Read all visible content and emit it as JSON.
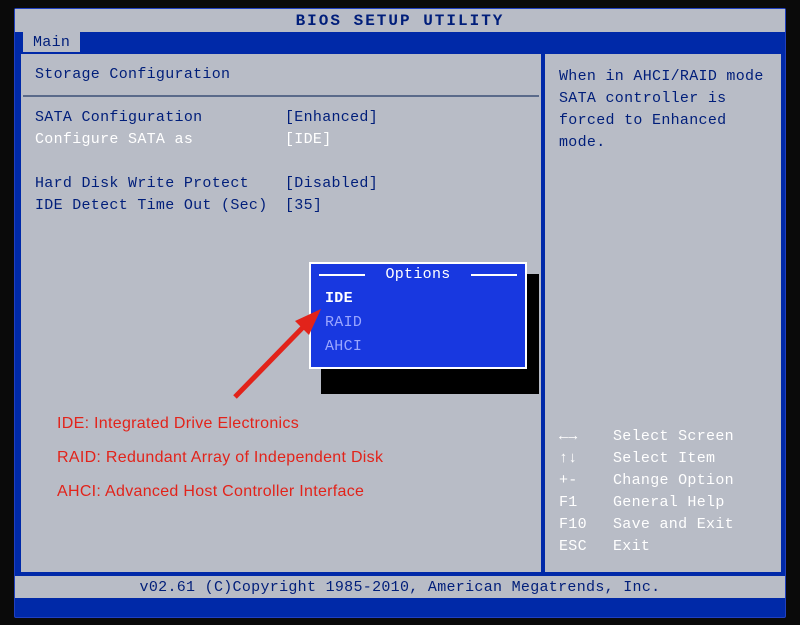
{
  "title": "BIOS SETUP UTILITY",
  "tab": "Main",
  "section": "Storage Configuration",
  "settings": {
    "sata_config": {
      "label": "SATA Configuration",
      "value": "[Enhanced]"
    },
    "configure_as": {
      "label": "Configure SATA as",
      "value": "[IDE]"
    },
    "hd_write_protect": {
      "label": "Hard Disk Write Protect",
      "value": "[Disabled]"
    },
    "ide_timeout": {
      "label": "IDE Detect Time Out (Sec)",
      "value": "[35]"
    }
  },
  "popup": {
    "title": "Options",
    "items": [
      "IDE",
      "RAID",
      "AHCI"
    ],
    "selected": "IDE"
  },
  "help_text": "When in AHCI/RAID mode SATA controller is forced to Enhanced mode.",
  "keys": [
    {
      "k": "←→",
      "d": "Select Screen"
    },
    {
      "k": "↑↓",
      "d": "Select Item"
    },
    {
      "k": "+-",
      "d": "Change Option"
    },
    {
      "k": "F1",
      "d": "General Help"
    },
    {
      "k": "F10",
      "d": "Save and Exit"
    },
    {
      "k": "ESC",
      "d": "Exit"
    }
  ],
  "footer": "v02.61 (C)Copyright 1985-2010, American Megatrends, Inc.",
  "annotations": {
    "ide": "IDE:  Integrated Drive Electronics",
    "raid": "RAID: Redundant Array of Independent Disk",
    "ahci": "AHCI: Advanced Host Controller Interface"
  }
}
